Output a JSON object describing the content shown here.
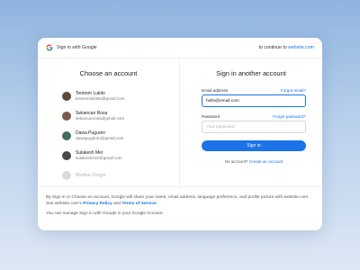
{
  "topbar": {
    "brand": "Sign in with Google",
    "continue_prefix": "to continue to ",
    "continue_site": "website.com"
  },
  "left": {
    "title": "Choose an account",
    "accounts": [
      {
        "name": "Tentrem Lukito",
        "email": "tentremlukit00@gmail.com",
        "avatar_color": "#5b4a3a"
      },
      {
        "name": "Sekancan Rosa",
        "email": "sekancanrosa@gmail.com",
        "avatar_color": "#7a5a48"
      },
      {
        "name": "Dawa Puguren",
        "email": "dawapug3r3n@gmail.com",
        "avatar_color": "#3f6d63"
      },
      {
        "name": "Sulakesh Mer",
        "email": "sulakeshmer@gmail.com",
        "avatar_color": "#4a4a4a"
      },
      {
        "name": "Madhav Ringui",
        "email": "",
        "avatar_color": "#9a9a9a"
      }
    ]
  },
  "right": {
    "title": "Sign in another account",
    "email_label": "Email address",
    "forgot_email": "Forgot email?",
    "email_value": "hello@email.com",
    "password_label": "Password",
    "forgot_password": "Forgot password?",
    "password_placeholder": "Your password",
    "signin_label": "Sign in",
    "no_account_text": "No account?",
    "create_account": "Create an account"
  },
  "footer": {
    "text1": "By Sign in or Choose an account, Google will share your name, email address, language preference, and profile picture with website.com. See website.com's ",
    "privacy": "Privacy Policy",
    "and": " and ",
    "terms": "Terms of Service",
    "dot": ".",
    "text2": "You can manage Sign in with Google in your Google Account."
  }
}
